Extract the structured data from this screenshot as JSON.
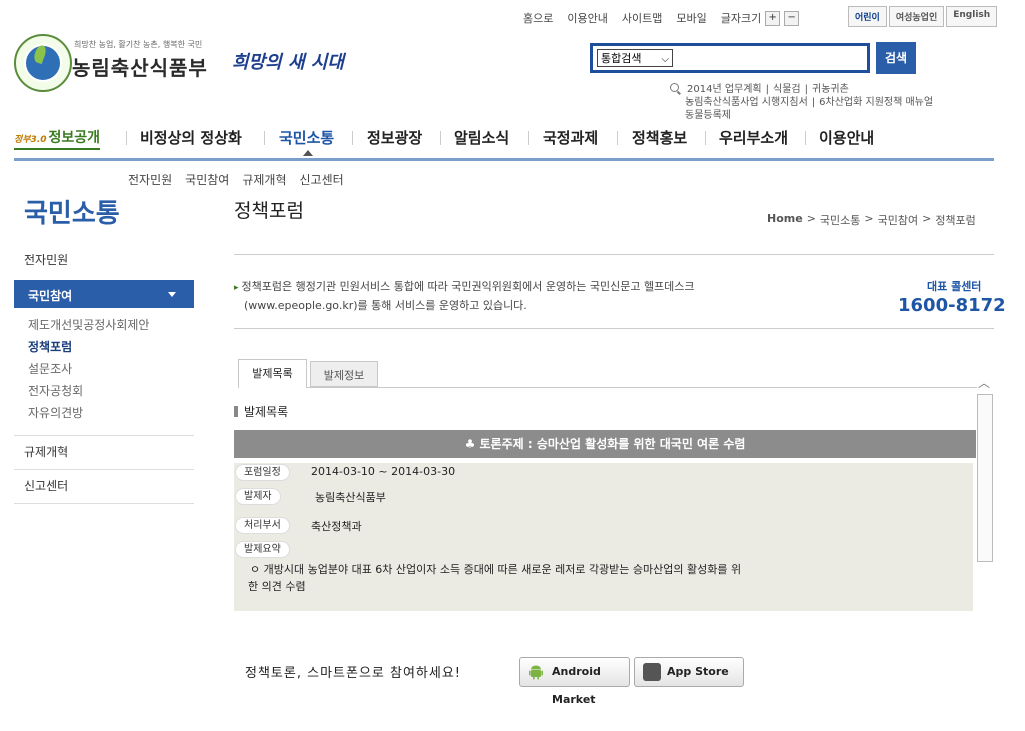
{
  "util": {
    "links": [
      "홈으로",
      "이용안내",
      "사이트맵",
      "모바일"
    ],
    "font_size_label": "글자크기",
    "font_plus": "+",
    "font_minus": "−"
  },
  "langs": [
    "어린이",
    "여성농업인",
    "English"
  ],
  "logo": {
    "slogan": "희망찬 농업, 활기찬 농촌, 행복한 국민",
    "ministry": "농림축산식품부",
    "hope": "희망의 새 시대"
  },
  "search": {
    "select_value": "통합검색",
    "button": "검색"
  },
  "popular": {
    "row1": [
      "2014년 업무계획",
      "식물검",
      "귀농귀촌"
    ],
    "row2": [
      "농림축산식품사업 시행지침서",
      "6차산업화 지원정책 매뉴얼"
    ],
    "row3": [
      "동물등록제"
    ]
  },
  "gnb": {
    "info_logo_prefix": "정부3.0",
    "info_logo": "정보공개",
    "items": [
      "비정상의 정상화",
      "국민소통",
      "정보광장",
      "알림소식",
      "국정과제",
      "정책홍보",
      "우리부소개",
      "이용안내"
    ]
  },
  "subnav": [
    "전자민원",
    "국민참여",
    "규제개혁",
    "신고센터"
  ],
  "lnb": {
    "title": "국민소통",
    "item1": "전자민원",
    "active": "국민참여",
    "subs": [
      "제도개선및공정사회제안",
      "정책포럼",
      "설문조사",
      "전자공청회",
      "자유의견방"
    ],
    "item3": "규제개혁",
    "item4": "신고센터"
  },
  "content": {
    "title": "정책포럼",
    "breadcrumb": [
      "Home",
      "국민소통",
      "국민참여",
      "정책포럼"
    ],
    "intro_line1": "정책포럼은 행정기관 민원서비스 통합에 따라 국민권익위원회에서 운영하는 국민신문고 헬프데스크",
    "intro_line2": "(www.epeople.go.kr)를 통해 서비스를 운영하고 있습니다.",
    "call_label": "대표 콜센터",
    "call_number": "1600-8172",
    "tabs": [
      "발제목록",
      "발제정보"
    ],
    "section_title": "발제목록",
    "topic": "♣ 토론주제 : 승마산업 활성화를 위한 대국민 여론 수렴",
    "fields": {
      "period_label": "포럼일정",
      "period": "2014-03-10 ~ 2014-03-30",
      "presenter_label": "발제자",
      "presenter": "농림축산식품부",
      "dept_label": "처리부서",
      "dept": "축산정책과",
      "summary_label": "발제요약",
      "summary_line1": "ㅇ 개방시대 농업분야 대표 6차 산업이자 소득 증대에 따른 새로운 레저로 각광받는 승마산업의 활성화를 위",
      "summary_line2": "한 의견 수렴"
    },
    "smart_text": "정책토론, 스마트폰으로 참여하세요!",
    "android": "Android Market",
    "appstore": "App Store"
  }
}
